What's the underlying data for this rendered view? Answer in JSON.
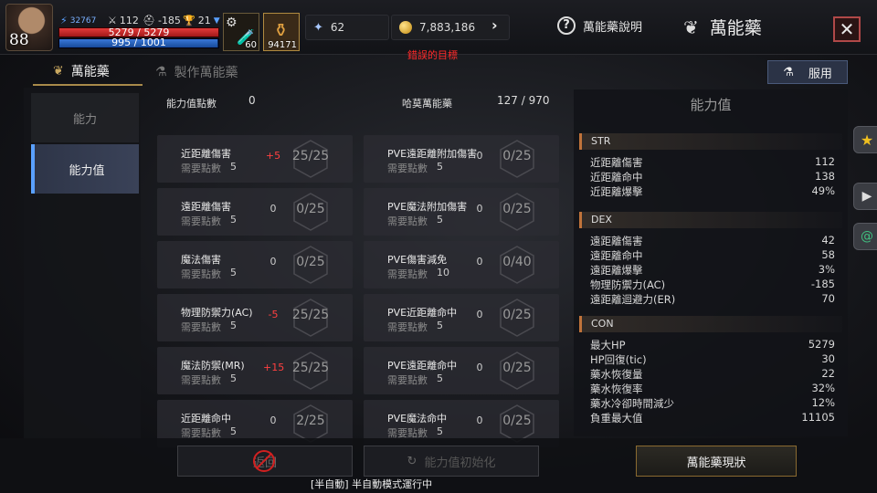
{
  "player": {
    "level": "88",
    "power": "32767",
    "stat_a": "112",
    "stat_b": "-185",
    "stat_c": "21",
    "hp_text": "5279 / 5279",
    "hp_fraction": 1.0,
    "mp_text": "995 / 1001",
    "mp_fraction": 0.994
  },
  "slots": {
    "slot1_count": "60",
    "slot2_count": "94171"
  },
  "currency": {
    "crystal": "62",
    "gold": "7,883,186"
  },
  "header": {
    "help_label": "萬能藥說明",
    "title": "萬能藥",
    "error_text": "錯誤的目標"
  },
  "tabs": [
    {
      "label": "萬能藥"
    },
    {
      "label": "製作萬能藥"
    }
  ],
  "use_button": "服用",
  "left_menu": [
    {
      "label": "能力"
    },
    {
      "label": "能力值"
    }
  ],
  "center": {
    "points_label": "能力值點數",
    "points_value": "0",
    "elixir_label": "哈莫萬能藥",
    "elixir_value": "127 / 970",
    "need_label": "需要點數",
    "rows": [
      {
        "name": "近距離傷害",
        "need": "5",
        "bonus": "+5",
        "value": "25/25"
      },
      {
        "name": "PVE遠距離附加傷害",
        "need": "5",
        "bonus": "0",
        "value": "0/25"
      },
      {
        "name": "遠距離傷害",
        "need": "5",
        "bonus": "0",
        "value": "0/25"
      },
      {
        "name": "PVE魔法附加傷害",
        "need": "5",
        "bonus": "0",
        "value": "0/25"
      },
      {
        "name": "魔法傷害",
        "need": "5",
        "bonus": "0",
        "value": "0/25"
      },
      {
        "name": "PVE傷害減免",
        "need": "10",
        "bonus": "0",
        "value": "0/40"
      },
      {
        "name": "物理防禦力(AC)",
        "need": "5",
        "bonus": "-5",
        "value": "25/25"
      },
      {
        "name": "PVE近距離命中",
        "need": "5",
        "bonus": "0",
        "value": "0/25"
      },
      {
        "name": "魔法防禦(MR)",
        "need": "5",
        "bonus": "+15",
        "value": "25/25"
      },
      {
        "name": "PVE遠距離命中",
        "need": "5",
        "bonus": "0",
        "value": "0/25"
      },
      {
        "name": "近距離命中",
        "need": "5",
        "bonus": "0",
        "value": "2/25"
      },
      {
        "name": "PVE魔法命中",
        "need": "5",
        "bonus": "0",
        "value": "0/25"
      }
    ]
  },
  "stats_panel": {
    "title": "能力值",
    "sections": [
      {
        "name": "STR",
        "rows": [
          {
            "k": "近距離傷害",
            "v": "112"
          },
          {
            "k": "近距離命中",
            "v": "138"
          },
          {
            "k": "近距離爆擊",
            "v": "49%"
          }
        ]
      },
      {
        "name": "DEX",
        "rows": [
          {
            "k": "遠距離傷害",
            "v": "42"
          },
          {
            "k": "遠距離命中",
            "v": "58"
          },
          {
            "k": "遠距離爆擊",
            "v": "3%"
          },
          {
            "k": "物理防禦力(AC)",
            "v": "-185"
          },
          {
            "k": "遠距離迴避力(ER)",
            "v": "70"
          }
        ]
      },
      {
        "name": "CON",
        "rows": [
          {
            "k": "最大HP",
            "v": "5279"
          },
          {
            "k": "HP回復(tic)",
            "v": "30"
          },
          {
            "k": "藥水恢復量",
            "v": "22"
          },
          {
            "k": "藥水恢復率",
            "v": "32%"
          },
          {
            "k": "藥水冷卻時間減少",
            "v": "12%"
          },
          {
            "k": "負重最大值",
            "v": "11105"
          }
        ]
      }
    ]
  },
  "bottom": {
    "btn1": "返回",
    "btn2": "能力值初始化",
    "btn3": "萬能藥現狀",
    "status": "[半自動] 半自動模式運行中"
  },
  "colors": {
    "accent": "#5aa0ff",
    "bonus_pos": "#ff4040",
    "bonus_neg": "#ff4040",
    "gold": "#c28a10"
  }
}
